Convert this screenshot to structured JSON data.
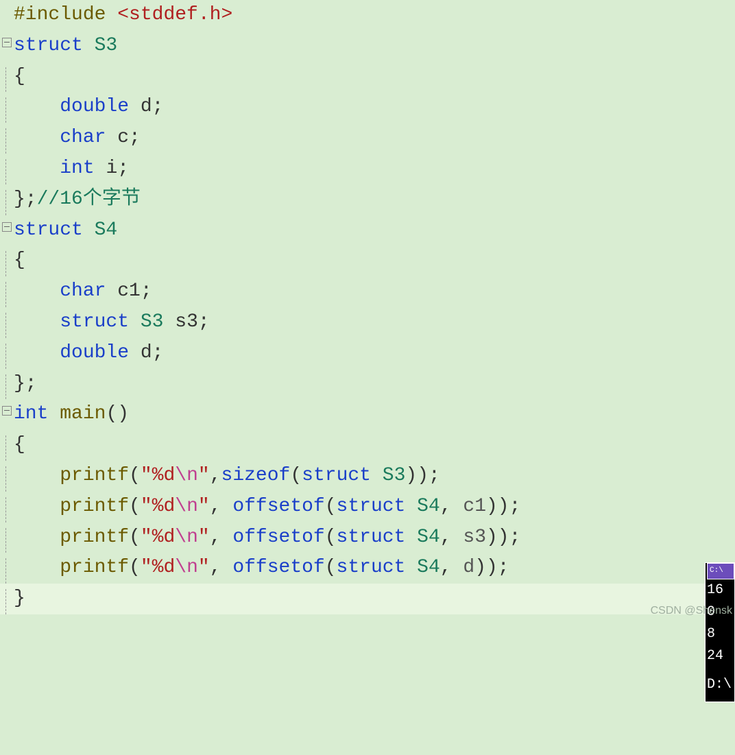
{
  "code": {
    "l1": {
      "preproc": "#include ",
      "header": "<stddef.h>"
    },
    "l2": {
      "kw": "struct ",
      "name": "S3"
    },
    "l3": {
      "brace": "{"
    },
    "l4": {
      "indent": "    ",
      "kw": "double ",
      "id": "d",
      "p": ";"
    },
    "l5": {
      "indent": "    ",
      "kw": "char ",
      "id": "c",
      "p": ";"
    },
    "l6": {
      "indent": "    ",
      "kw": "int ",
      "id": "i",
      "p": ";"
    },
    "l7": {
      "brace": "};",
      "comment": "//16个字节"
    },
    "l8": {
      "kw": "struct ",
      "name": "S4"
    },
    "l9": {
      "brace": "{"
    },
    "l10": {
      "indent": "    ",
      "kw": "char ",
      "id": "c1",
      "p": ";"
    },
    "l11": {
      "indent": "    ",
      "kw": "struct ",
      "type": "S3 ",
      "id": "s3",
      "p": ";"
    },
    "l12": {
      "indent": "    ",
      "kw": "double ",
      "id": "d",
      "p": ";"
    },
    "l13": {
      "brace": "};"
    },
    "l14": {
      "kw": "int ",
      "fn": "main",
      "p": "()"
    },
    "l15": {
      "brace": "{"
    },
    "l16": {
      "indent": "    ",
      "fn": "printf",
      "open": "(",
      "str1": "\"%d",
      "esc": "\\n",
      "str2": "\"",
      "comma": ",",
      "bi": "sizeof",
      "args": "(",
      "kw2": "struct ",
      "type2": "S3",
      "close": "));"
    },
    "l17": {
      "indent": "    ",
      "fn": "printf",
      "open": "(",
      "str1": "\"%d",
      "esc": "\\n",
      "str2": "\"",
      "comma": ", ",
      "bi": "offsetof",
      "args": "(",
      "kw2": "struct ",
      "type2": "S4",
      "comma2": ", ",
      "param": "c1",
      "close": "));"
    },
    "l18": {
      "indent": "    ",
      "fn": "printf",
      "open": "(",
      "str1": "\"%d",
      "esc": "\\n",
      "str2": "\"",
      "comma": ", ",
      "bi": "offsetof",
      "args": "(",
      "kw2": "struct ",
      "type2": "S4",
      "comma2": ", ",
      "param": "s3",
      "close": "));"
    },
    "l19": {
      "indent": "    ",
      "fn": "printf",
      "open": "(",
      "str1": "\"%d",
      "esc": "\\n",
      "str2": "\"",
      "comma": ", ",
      "bi": "offsetof",
      "args": "(",
      "kw2": "struct ",
      "type2": "S4",
      "comma2": ", ",
      "param": "d",
      "close": "));"
    },
    "l20": {
      "brace": "}"
    }
  },
  "console": {
    "title": "C:\\",
    "out1": "16",
    "out2": "0",
    "out3": "8",
    "out4": "24",
    "prompt": "D:\\"
  },
  "watermark": "CSDN @Shensk"
}
